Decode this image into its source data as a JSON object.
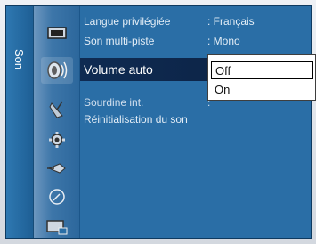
{
  "category": {
    "label": "Son"
  },
  "icons": [
    "picture-icon",
    "sound-icon",
    "channel-icon",
    "setup-icon",
    "input-icon",
    "application-icon",
    "support-icon"
  ],
  "menu": {
    "items": [
      {
        "label": "Langue privilégiée",
        "value": ": Français"
      },
      {
        "label": "Son multi-piste",
        "value": ": Mono"
      },
      {
        "label": "Volume auto",
        "value": ":"
      },
      {
        "label": "Sourdine int.",
        "value": ":"
      },
      {
        "label": "Réinitialisation du son",
        "value": ""
      }
    ]
  },
  "dropdown": {
    "options": [
      "Off",
      "On"
    ],
    "selected": "Off"
  },
  "colors": {
    "background": "#2a6ea6",
    "selected_row": "#0f2b52",
    "dropdown_bg": "#ffffff"
  }
}
